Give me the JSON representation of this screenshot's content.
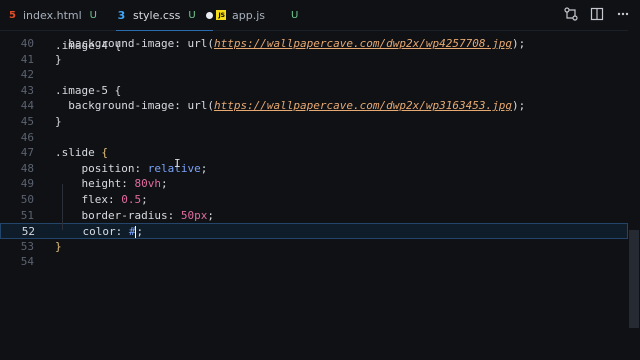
{
  "tabs": [
    {
      "name": "index.html",
      "status": "U",
      "icon": "html-file-icon"
    },
    {
      "name": "style.css",
      "status": "U",
      "icon": "css-file-icon",
      "active": true,
      "unsaved": true
    },
    {
      "name": "app.js",
      "status": "U",
      "icon": "js-file-icon"
    }
  ],
  "icons": {
    "js_badge": "JS"
  },
  "editor": {
    "lines": [
      {
        "num": "40",
        "parts": [
          {
            "t": "  background-image: ",
            "c": "c-prop"
          },
          {
            "t": "url(",
            "c": "c-fn"
          },
          {
            "t": "https://wallpapercave.com/dwp2x/wp4257708.jpg",
            "c": "c-url"
          },
          {
            "t": ");",
            "c": "c-punc"
          }
        ]
      },
      {
        "num": "41",
        "parts": [
          {
            "t": "}",
            "c": "c-punc"
          }
        ]
      },
      {
        "num": "42",
        "parts": []
      },
      {
        "num": "43",
        "parts": [
          {
            "t": ".image-5 ",
            "c": "c-sel"
          },
          {
            "t": "{",
            "c": "c-punc"
          }
        ]
      },
      {
        "num": "44",
        "parts": [
          {
            "t": "  background-image: ",
            "c": "c-prop"
          },
          {
            "t": "url(",
            "c": "c-fn"
          },
          {
            "t": "https://wallpapercave.com/dwp2x/wp3163453.jpg",
            "c": "c-url"
          },
          {
            "t": ");",
            "c": "c-punc"
          }
        ]
      },
      {
        "num": "45",
        "parts": [
          {
            "t": "}",
            "c": "c-punc"
          }
        ]
      },
      {
        "num": "46",
        "parts": []
      },
      {
        "num": "47",
        "parts": [
          {
            "t": ".slide ",
            "c": "c-sel"
          },
          {
            "t": "{",
            "c": "c-brace"
          }
        ]
      },
      {
        "num": "48",
        "parts": [
          {
            "t": "    position: ",
            "c": "c-prop"
          },
          {
            "t": "relative",
            "c": "c-val"
          },
          {
            "t": ";",
            "c": "c-punc"
          }
        ]
      },
      {
        "num": "49",
        "parts": [
          {
            "t": "    height: ",
            "c": "c-prop"
          },
          {
            "t": "80vh",
            "c": "c-num"
          },
          {
            "t": ";",
            "c": "c-punc"
          }
        ]
      },
      {
        "num": "50",
        "parts": [
          {
            "t": "    flex: ",
            "c": "c-prop"
          },
          {
            "t": "0.5",
            "c": "c-num"
          },
          {
            "t": ";",
            "c": "c-punc"
          }
        ]
      },
      {
        "num": "51",
        "parts": [
          {
            "t": "    border-radius: ",
            "c": "c-prop"
          },
          {
            "t": "50px",
            "c": "c-num"
          },
          {
            "t": ";",
            "c": "c-punc"
          }
        ]
      },
      {
        "num": "52",
        "current": true,
        "parts": [
          {
            "t": "    color: ",
            "c": "c-prop"
          },
          {
            "t": "#",
            "c": "c-hash"
          },
          {
            "t": ";",
            "c": "c-punc"
          }
        ]
      },
      {
        "num": "53",
        "parts": [
          {
            "t": "}",
            "c": "c-brace"
          }
        ]
      },
      {
        "num": "54",
        "parts": []
      }
    ],
    "partial_top_line": {
      "parts": [
        {
          "t": ".image-4 ",
          "c": "c-sel"
        },
        {
          "t": "{",
          "c": "c-punc"
        }
      ]
    }
  }
}
